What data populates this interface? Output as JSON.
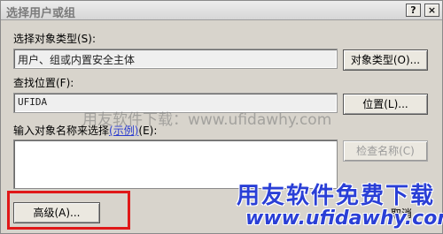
{
  "window": {
    "title": "选择用户或组",
    "help_label": "?",
    "close_label": "×"
  },
  "object_type": {
    "label": "选择对象类型(S):",
    "value": "用户、组或内置安全主体",
    "button_label": "对象类型(O)..."
  },
  "location": {
    "label": "查找位置(F):",
    "value": "UFIDA",
    "button_label": "位置(L)..."
  },
  "names": {
    "label_prefix": "输入对象名称来选择",
    "label_link": "(示例)",
    "label_suffix": "(E):",
    "value": "",
    "check_names_label": "检查名称(C)"
  },
  "buttons": {
    "advanced_label": "高级(A)...",
    "partial_label": "取消"
  },
  "watermarks": {
    "center_text": "用友软件下载：www.ufidawhy.com",
    "big_text": "用友软件免费下载",
    "url_text": "www.ufidawhy.com"
  },
  "colors": {
    "highlight_border": "#e01818",
    "watermark_blue": "#2a3fd6",
    "dialog_bg": "#d8d4cc"
  }
}
